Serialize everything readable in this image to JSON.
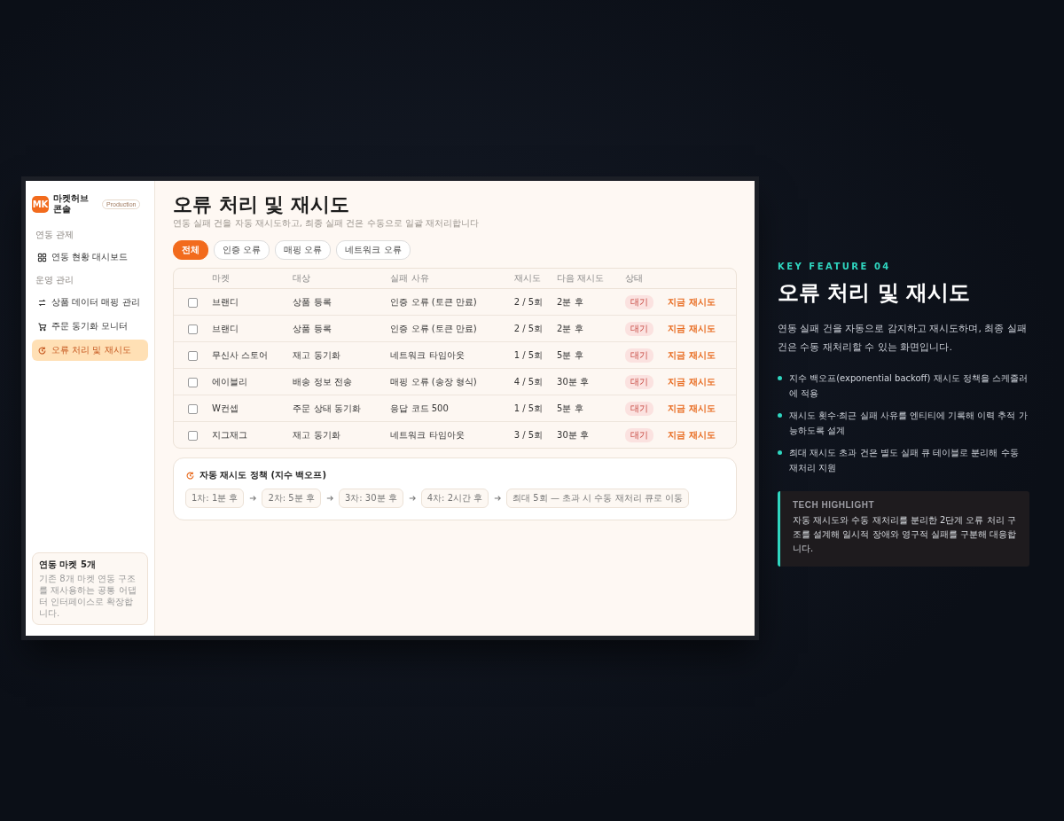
{
  "sidebar": {
    "logo": "MK",
    "name": "마켓허브 콘솔",
    "badge": "Production",
    "sections": [
      {
        "title": "연동 관제",
        "items": [
          {
            "label": "연동 현황 대시보드",
            "selected": false
          }
        ]
      },
      {
        "title": "운영 관리",
        "items": [
          {
            "label": "상품 데이터 매핑 관리",
            "selected": false
          },
          {
            "label": "주문 동기화 모니터",
            "selected": false
          },
          {
            "label": "오류 처리 및 재시도",
            "selected": true
          }
        ]
      }
    ],
    "footer": {
      "title": "연동 마켓 5개",
      "text": "기존 8개 마켓 연동 구조를 재사용하는 공통 어댑터 인터페이스로 확장합니다."
    }
  },
  "main": {
    "title": "오류 처리 및 재시도",
    "subtitle": "연동 실패 건을 자동 재시도하고, 최종 실패 건은 수동으로 일괄 재처리합니다",
    "filters": [
      {
        "label": "전체",
        "selected": true
      },
      {
        "label": "인증 오류",
        "selected": false
      },
      {
        "label": "매핑 오류",
        "selected": false
      },
      {
        "label": "네트워크 오류",
        "selected": false
      }
    ],
    "table": {
      "columns": [
        "마켓",
        "대상",
        "실패 사유",
        "재시도",
        "다음 재시도",
        "상태"
      ],
      "rows": [
        {
          "checked": false,
          "market": "브랜디",
          "target": "상품 등록",
          "reason": "인증 오류 (토큰 만료)",
          "retry": "2 / 5회",
          "next": "2분 후",
          "status": "대기",
          "action": "지금 재시도"
        },
        {
          "checked": false,
          "market": "브랜디",
          "target": "상품 등록",
          "reason": "인증 오류 (토큰 만료)",
          "retry": "2 / 5회",
          "next": "2분 후",
          "status": "대기",
          "action": "지금 재시도"
        },
        {
          "checked": false,
          "market": "무신사 스토어",
          "target": "재고 동기화",
          "reason": "네트워크 타임아웃",
          "retry": "1 / 5회",
          "next": "5분 후",
          "status": "대기",
          "action": "지금 재시도"
        },
        {
          "checked": false,
          "market": "에이블리",
          "target": "배송 정보 전송",
          "reason": "매핑 오류 (송장 형식)",
          "retry": "4 / 5회",
          "next": "30분 후",
          "status": "대기",
          "action": "지금 재시도"
        },
        {
          "checked": false,
          "market": "W컨셉",
          "target": "주문 상태 동기화",
          "reason": "응답 코드 500",
          "retry": "1 / 5회",
          "next": "5분 후",
          "status": "대기",
          "action": "지금 재시도"
        },
        {
          "checked": false,
          "market": "지그재그",
          "target": "재고 동기화",
          "reason": "네트워크 타임아웃",
          "retry": "3 / 5회",
          "next": "30분 후",
          "status": "대기",
          "action": "지금 재시도"
        }
      ]
    },
    "policy": {
      "title": "자동 재시도 정책 (지수 백오프)",
      "steps": [
        "1차: 1분 후",
        "2차: 5분 후",
        "3차: 30분 후",
        "4차: 2시간 후",
        "최대 5회 — 초과 시 수동 재처리 큐로 이동"
      ]
    }
  },
  "feature": {
    "eyebrow": "KEY FEATURE 04",
    "title": "오류 처리 및 재시도",
    "description": "연동 실패 건을 자동으로 감지하고 재시도하며, 최종 실패 건은 수동 재처리할 수 있는 화면입니다.",
    "bullets": [
      "지수 백오프(exponential backoff) 재시도 정책을 스케줄러에 적용",
      "재시도 횟수·최근 실패 사유를 엔티티에 기록해 이력 추적 가능하도록 설계",
      "최대 재시도 초과 건은 별도 실패 큐 테이블로 분리해 수동 재처리 지원"
    ],
    "highlight": {
      "title": "TECH HIGHLIGHT",
      "text": "자동 재시도와 수동 재처리를 분리한 2단계 오류 처리 구조를 설계해 일시적 장애와 영구적 실패를 구분해 대응합니다."
    }
  }
}
